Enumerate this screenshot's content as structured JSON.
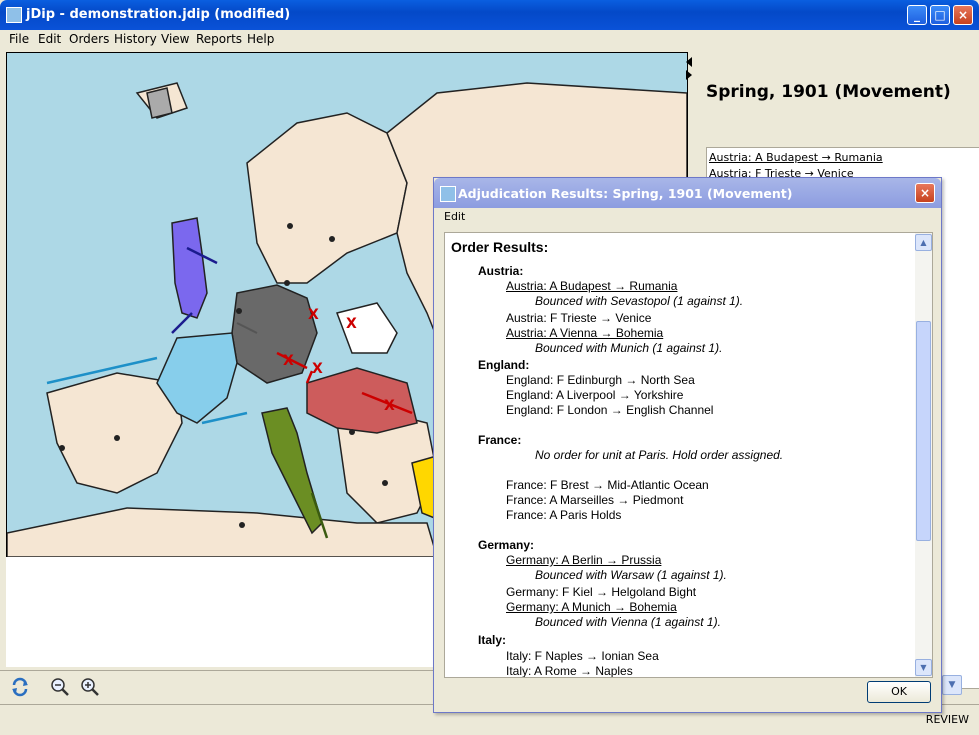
{
  "window": {
    "title": "jDip - demonstration.jdip (modified)",
    "minimize": "_",
    "maximize": "□",
    "close": "×"
  },
  "menu": [
    "File",
    "Edit",
    "Orders",
    "History",
    "View",
    "Reports",
    "Help"
  ],
  "phase": "Spring, 1901 (Movement)",
  "order_list": [
    "Austria: A Budapest → Rumania",
    "Austria: F Trieste → Venice"
  ],
  "dialog": {
    "title": "Adjudication Results: Spring, 1901 (Movement)",
    "menu": "Edit",
    "heading": "Order Results:",
    "ok": "OK",
    "close": "×",
    "lines": [
      {
        "text": "Austria:",
        "style": "country"
      },
      {
        "text": "Austria: A Budapest → Rumania",
        "style": "failed"
      },
      {
        "text": "Bounced with Sevastopol (1 against 1).",
        "style": "note"
      },
      {
        "text": "Austria: F Trieste → Venice",
        "style": "order"
      },
      {
        "text": "Austria: A Vienna → Bohemia",
        "style": "failed"
      },
      {
        "text": "Bounced with Munich (1 against 1).",
        "style": "note"
      },
      {
        "text": "England:",
        "style": "country"
      },
      {
        "text": "England: F Edinburgh → North Sea",
        "style": "order"
      },
      {
        "text": "England: A Liverpool → Yorkshire",
        "style": "order"
      },
      {
        "text": "England: F London → English Channel",
        "style": "order"
      },
      {
        "text": "France:",
        "style": "country"
      },
      {
        "text": "No order for unit at Paris. Hold order assigned.",
        "style": "note"
      },
      {
        "text": "France: F Brest → Mid-Atlantic Ocean",
        "style": "order"
      },
      {
        "text": "France: A Marseilles → Piedmont",
        "style": "order"
      },
      {
        "text": "France: A Paris Holds",
        "style": "order"
      },
      {
        "text": "Germany:",
        "style": "country"
      },
      {
        "text": "Germany: A Berlin → Prussia",
        "style": "failed"
      },
      {
        "text": "Bounced with Warsaw (1 against 1).",
        "style": "note"
      },
      {
        "text": "Germany: F Kiel → Helgoland Bight",
        "style": "order"
      },
      {
        "text": "Germany: A Munich → Bohemia",
        "style": "failed"
      },
      {
        "text": "Bounced with Vienna (1 against 1).",
        "style": "note"
      },
      {
        "text": "Italy:",
        "style": "country"
      },
      {
        "text": "Italy: F Naples → Ionian Sea",
        "style": "order"
      },
      {
        "text": "Italy: A Rome → Naples",
        "style": "order"
      }
    ]
  },
  "status": "REVIEW",
  "colors": {
    "sea": "#add8e6",
    "neutral": "#f5e6d3",
    "austria": "#cd5c5c",
    "england": "#7b68ee",
    "france": "#87ceeb",
    "germany": "#696969",
    "italy": "#6b8e23",
    "russia": "#ffffff",
    "turkey": "#ffd700",
    "move_red": "#cc0000"
  }
}
